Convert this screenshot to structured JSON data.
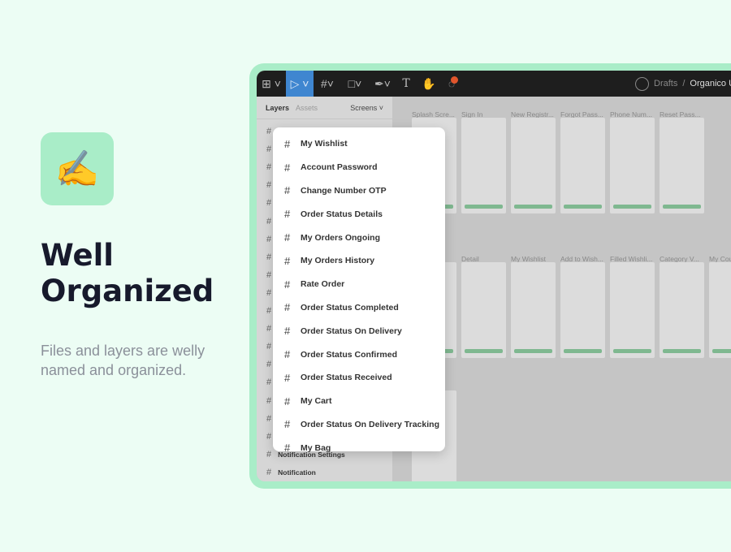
{
  "hero": {
    "icon": "writing-hand-emoji",
    "icon_glyph": "✍️",
    "title_line1": "Well",
    "title_line2": "Organized",
    "subtitle": "Files and layers are welly named and organized."
  },
  "toolbar": {
    "breadcrumb_parent": "Drafts",
    "separator": "/",
    "breadcrumb_current": "Organico U",
    "notification_color": "#e0552c",
    "active_color": "#3f86d0"
  },
  "panel": {
    "tab_layers": "Layers",
    "tab_assets": "Assets",
    "page_selector": "Screens",
    "layers_visible": [
      "My Wishlist",
      "Notification Settings",
      "Notification"
    ]
  },
  "frames": {
    "row1": [
      "Splash Scre...",
      "Sign In",
      "New Registr...",
      "Forgot Pass...",
      "Phone Num...",
      "Reset Pass..."
    ],
    "row2": [
      "en",
      "Detail",
      "My Wishlist",
      "Add to Wish...",
      "Filled Wishli...",
      "Category V...",
      "My Cou"
    ]
  },
  "dropdown": {
    "items": [
      "My Wishlist",
      "Account Password",
      "Change Number OTP",
      "Order Status Details",
      "My Orders Ongoing",
      "My Orders History",
      "Rate Order",
      "Order Status Completed",
      "Order Status On Delivery",
      "Order Status Confirmed",
      "Order Status Received",
      "My Cart",
      "Order Status On Delivery Tracking",
      "My Bag"
    ]
  },
  "colors": {
    "background": "#ecfdf4",
    "accent": "#a9edc8",
    "title": "#171a2c"
  }
}
